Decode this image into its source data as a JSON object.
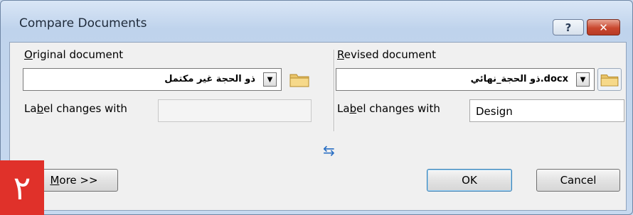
{
  "window": {
    "title": "Compare Documents",
    "help_label": "?",
    "close_label": "✕"
  },
  "original": {
    "heading_prefix": "",
    "heading_underlined": "O",
    "heading_rest": "riginal document",
    "selected_file": "ذو الحجة غير مكتمل",
    "label_prefix": "La",
    "label_underlined": "b",
    "label_rest": "el changes with",
    "label_value": ""
  },
  "revised": {
    "heading_underlined": "R",
    "heading_rest": "evised document",
    "selected_file": "docx.ذو الحجة_نهائي",
    "label_prefix": "La",
    "label_underlined": "b",
    "label_rest": "el changes with",
    "label_value": "Design"
  },
  "buttons": {
    "more_underlined": "M",
    "more_rest": "ore >>",
    "ok": "OK",
    "cancel": "Cancel"
  },
  "overlay": {
    "badge_text": "٢",
    "badge_color": "#e0312a"
  },
  "icons": {
    "swap": "⇆",
    "folder": "folder-icon",
    "dropdown": "▼"
  }
}
